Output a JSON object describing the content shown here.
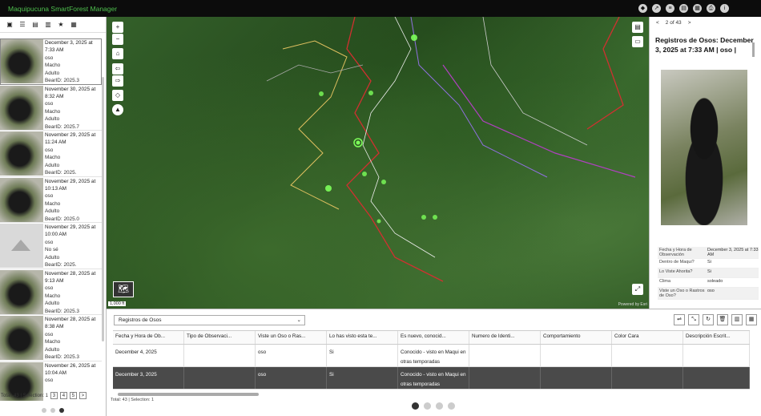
{
  "app": {
    "title": "Maquipucuna SmartForest Manager"
  },
  "left_panel": {
    "items": [
      {
        "date": "December 3, 2025 at 7:33 AM",
        "species": "oso",
        "sex": "Macho",
        "age": "Adulto",
        "bear_id": "BearID: 2025.3"
      },
      {
        "date": "November 30, 2025 at 8:32 AM",
        "species": "oso",
        "sex": "Macho",
        "age": "Adulto",
        "bear_id": "BearID: 2025.7"
      },
      {
        "date": "November 29, 2025 at 11:24 AM",
        "species": "oso",
        "sex": "Macho",
        "age": "Adulto",
        "bear_id": "BearID: 2025."
      },
      {
        "date": "November 29, 2025 at 10:13 AM",
        "species": "oso",
        "sex": "Macho",
        "age": "Adulto",
        "bear_id": "BearID: 2025.0"
      },
      {
        "date": "November 29, 2025 at 10:00 AM",
        "species": "oso",
        "sex": "No sé",
        "age": "Adulto",
        "bear_id": "BearID: 2025."
      },
      {
        "date": "November 28, 2025 at 9:13 AM",
        "species": "oso",
        "sex": "Macho",
        "age": "Adulto",
        "bear_id": "BearID: 2025.3"
      },
      {
        "date": "November 28, 2025 at 8:38 AM",
        "species": "oso",
        "sex": "Macho",
        "age": "Adulto",
        "bear_id": "BearID: 2025.3"
      },
      {
        "date": "November 26, 2025 at 10:04 AM",
        "species": "oso",
        "sex": "",
        "age": "",
        "bear_id": ""
      }
    ],
    "footer": "Total: 43 | Selection: 1",
    "pages": [
      "3",
      "4",
      "5",
      ">"
    ]
  },
  "map": {
    "scale": "1,000 ft",
    "attribution": "Powered by Esri"
  },
  "right_panel": {
    "nav": {
      "prev": "<",
      "counter": "2 of 43",
      "next": ">"
    },
    "title": "Registros de Osos: December 3, 2025 at 7:33 AM | oso |",
    "rows": [
      {
        "key": "Fecha y Hora de Observación",
        "value": "December 3, 2025 at 7:33 AM"
      },
      {
        "key": "Dentro de Maqui?",
        "value": "Si"
      },
      {
        "key": "Lo Viste Ahorita?",
        "value": "Si"
      },
      {
        "key": "Clima",
        "value": "soleado"
      },
      {
        "key": "Viste un Oso o Rastros de Oso?",
        "value": "oso"
      }
    ]
  },
  "table": {
    "layer": "Registros de Osos",
    "columns": [
      "Fecha y Hora de Ob...",
      "Tipo de Observaci...",
      "Viste un Oso o Ras...",
      "Lo has visto esta te...",
      "Es nuevo, conocid...",
      "Numero de Identi...",
      "Comportamiento",
      "Color Cara",
      "Descripción Escrit..."
    ],
    "rows": [
      [
        "December 4, 2025",
        "",
        "oso",
        "Si",
        "Conocido - visto en Maqui en otras temporadas",
        "",
        "",
        "",
        ""
      ],
      [
        "December 3, 2025",
        "",
        "oso",
        "Si",
        "Conocido - visto en Maqui en otras temporadas",
        "",
        "",
        "",
        ""
      ]
    ],
    "footer": "Total: 43 | Selection: 1"
  }
}
